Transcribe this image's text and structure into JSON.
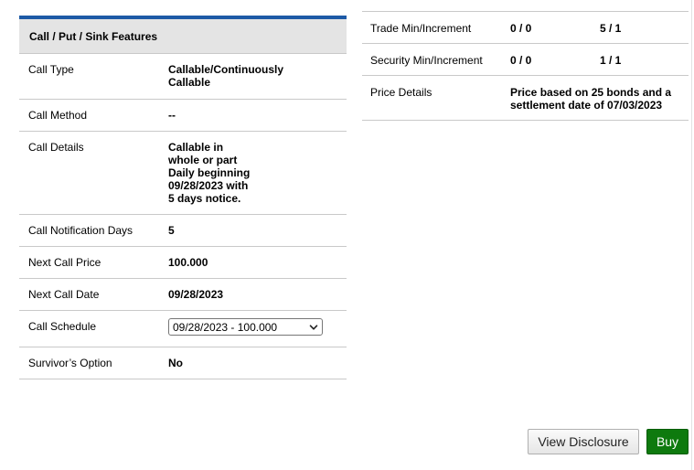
{
  "call_features": {
    "header": "Call / Put / Sink Features",
    "call_type": {
      "label": "Call Type",
      "value_line1": "Callable/Continuously",
      "value_line2": "Callable"
    },
    "call_method": {
      "label": "Call Method",
      "value": "--"
    },
    "call_details": {
      "label": "Call Details",
      "lines": [
        "Callable in",
        "whole or part",
        "Daily beginning",
        "09/28/2023 with",
        "5 days notice."
      ]
    },
    "call_notification_days": {
      "label": "Call Notification Days",
      "value": "5"
    },
    "next_call_price": {
      "label": "Next Call Price",
      "value": "100.000"
    },
    "next_call_date": {
      "label": "Next Call Date",
      "value": "09/28/2023"
    },
    "call_schedule": {
      "label": "Call Schedule",
      "selected": "09/28/2023 - 100.000"
    },
    "survivors_option": {
      "label": "Survivor’s Option",
      "value": "No"
    }
  },
  "trade_details": {
    "trade_min": {
      "label": "Trade Min/Increment",
      "value1": "0 / 0",
      "value2": "5 / 1"
    },
    "security_min": {
      "label": "Security Min/Increment",
      "value1": "0 / 0",
      "value2": "1 / 1"
    },
    "price_details": {
      "label": "Price Details",
      "value_line1": "Price based on 25 bonds and a",
      "value_line2": "settlement date of 07/03/2023"
    }
  },
  "actions": {
    "view_disclosure": "View Disclosure",
    "buy": "Buy"
  },
  "colors": {
    "header_accent": "#1d5aa6",
    "buy_button": "#0e7a0e"
  }
}
